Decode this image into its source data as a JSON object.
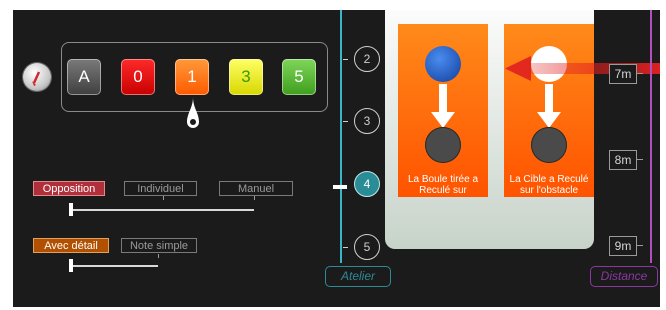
{
  "scores": {
    "reset_icon": "reset-icon",
    "items": [
      {
        "label": "A"
      },
      {
        "label": "0"
      },
      {
        "label": "1"
      },
      {
        "label": "3"
      },
      {
        "label": "5"
      }
    ],
    "selected": "1"
  },
  "mode": {
    "options": [
      "Opposition",
      "Individuel",
      "Manuel"
    ],
    "selected": "Opposition",
    "slider_level": 0.0
  },
  "detail": {
    "options": [
      "Avec détail",
      "Note simple"
    ],
    "selected": "Avec détail",
    "slider_level": 0.0
  },
  "atelier": {
    "numbers": [
      "2",
      "3",
      "4",
      "5"
    ],
    "active": "4",
    "label": "Atelier"
  },
  "panels": [
    {
      "text_line1": "La Boule tirée a",
      "text_line2": "Reculé sur"
    },
    {
      "text_line1": "La Cible a Reculé",
      "text_line2": "sur l'obstacle"
    }
  ],
  "distance": {
    "markers": [
      "7m",
      "8m",
      "9m"
    ],
    "label": "Distance"
  },
  "colors": {
    "accent_teal": "#39b7c8",
    "accent_purple": "#b24fbf",
    "panel_orange": "#ff5300",
    "arrow_red": "#e02020"
  }
}
